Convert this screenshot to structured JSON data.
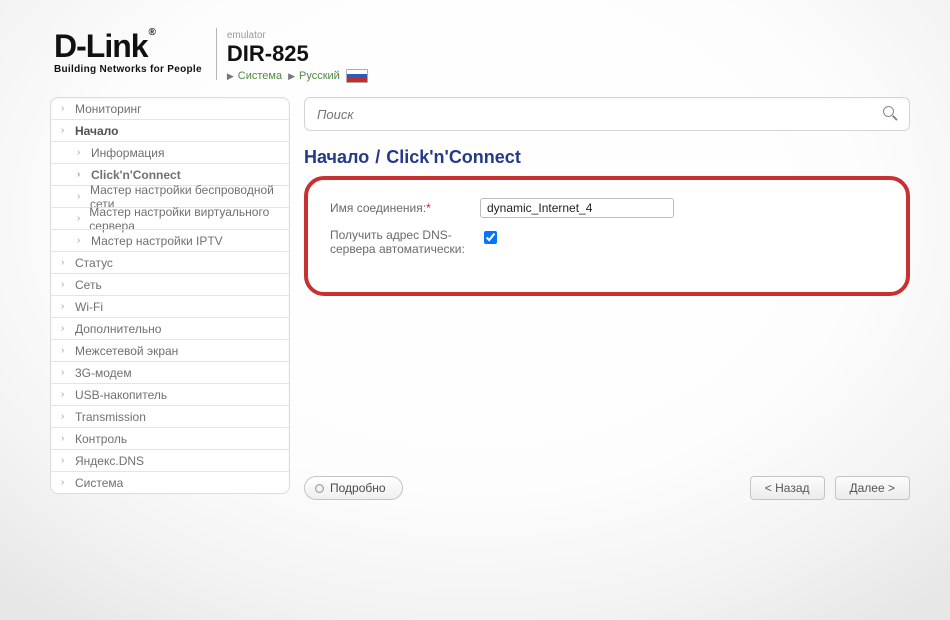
{
  "header": {
    "brand": "D-Link",
    "tagline": "Building Networks for People",
    "emulator": "emulator",
    "model": "DIR-825",
    "crumb_system": "Система",
    "crumb_lang": "Русский"
  },
  "search": {
    "placeholder": "Поиск"
  },
  "sidebar": {
    "items": [
      {
        "label": "Мониторинг",
        "level": 1
      },
      {
        "label": "Начало",
        "level": 1,
        "top": true
      },
      {
        "label": "Информация",
        "level": 2
      },
      {
        "label": "Click'n'Connect",
        "level": 2,
        "current": true
      },
      {
        "label": "Мастер настройки беспроводной сети",
        "level": 2
      },
      {
        "label": "Мастер настройки виртуального сервера",
        "level": 2
      },
      {
        "label": "Мастер настройки IPTV",
        "level": 2
      },
      {
        "label": "Статус",
        "level": 1
      },
      {
        "label": "Сеть",
        "level": 1
      },
      {
        "label": "Wi-Fi",
        "level": 1
      },
      {
        "label": "Дополнительно",
        "level": 1
      },
      {
        "label": "Межсетевой экран",
        "level": 1
      },
      {
        "label": "3G-модем",
        "level": 1
      },
      {
        "label": "USB-накопитель",
        "level": 1
      },
      {
        "label": "Transmission",
        "level": 1
      },
      {
        "label": "Контроль",
        "level": 1
      },
      {
        "label": "Яндекс.DNS",
        "level": 1
      },
      {
        "label": "Система",
        "level": 1
      }
    ]
  },
  "breadcrumb": {
    "root": "Начало",
    "sep": "/",
    "leaf": "Click'n'Connect"
  },
  "form": {
    "conn_name_label": "Имя соединения:",
    "conn_name_value": "dynamic_Internet_4",
    "dns_auto_label": "Получить адрес DNS-сервера автоматически:",
    "dns_auto_checked": true
  },
  "buttons": {
    "details": "Подробно",
    "back": "< Назад",
    "next": "Далее >"
  }
}
